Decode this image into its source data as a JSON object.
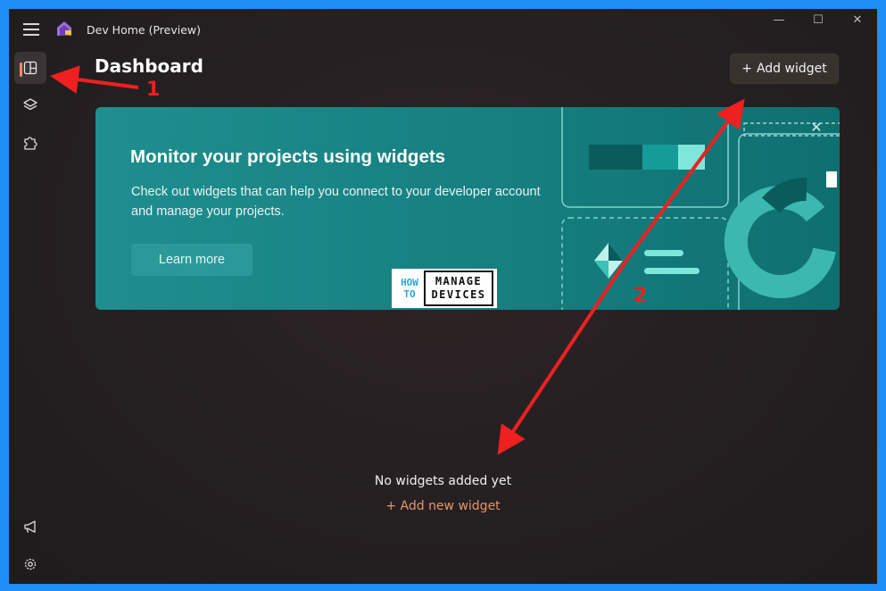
{
  "window": {
    "title": "Dev Home (Preview)"
  },
  "controls": {
    "minimize": "—",
    "maximize": "☐",
    "close": "✕"
  },
  "nav": {
    "items": [
      {
        "name": "dashboard",
        "icon": "dashboard-icon",
        "active": true
      },
      {
        "name": "machine-configuration",
        "icon": "layers-icon",
        "active": false
      },
      {
        "name": "extensions",
        "icon": "puzzle-icon",
        "active": false
      }
    ],
    "bottom": [
      {
        "name": "feedback",
        "icon": "megaphone-icon"
      },
      {
        "name": "settings",
        "icon": "gear-icon"
      }
    ]
  },
  "header": {
    "title": "Dashboard",
    "add_widget_plus": "+",
    "add_widget_label": "Add widget"
  },
  "banner": {
    "title": "Monitor your projects using widgets",
    "description": "Check out widgets that can help you connect to your developer account and manage your projects.",
    "learn_more": "Learn more",
    "close": "✕"
  },
  "watermark": {
    "left_top": "HOW",
    "left_bottom": "TO",
    "right_top": "MANAGE",
    "right_bottom": "DEVICES"
  },
  "empty_state": {
    "message": "No widgets added yet",
    "link": "+ Add new widget"
  },
  "annotations": [
    {
      "label": "1"
    },
    {
      "label": "2"
    }
  ],
  "colors": {
    "accent": "#f08a6a",
    "banner": "#167f80",
    "annotation": "#ee2020",
    "frame": "#1e8ff5"
  }
}
